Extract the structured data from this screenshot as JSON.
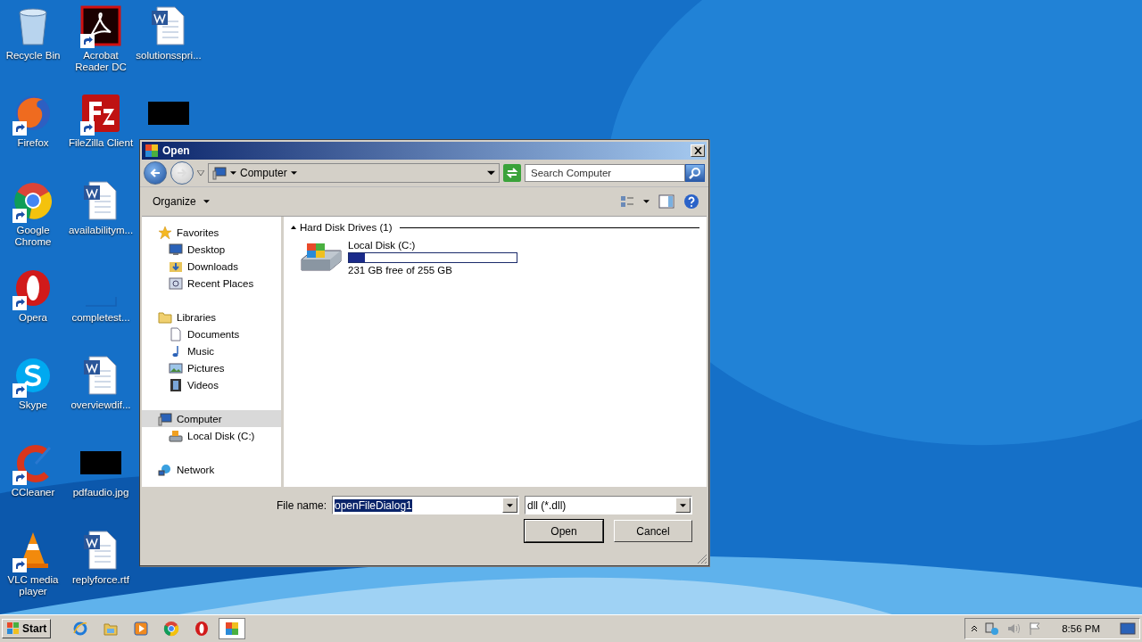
{
  "desktop": {
    "icons": [
      {
        "kind": "recycle",
        "label": "Recycle Bin",
        "shortcut": false
      },
      {
        "kind": "firefox",
        "label": "Firefox",
        "shortcut": true
      },
      {
        "kind": "chrome",
        "label": "Google Chrome",
        "shortcut": true
      },
      {
        "kind": "opera",
        "label": "Opera",
        "shortcut": true
      },
      {
        "kind": "skype",
        "label": "Skype",
        "shortcut": true
      },
      {
        "kind": "ccleaner",
        "label": "CCleaner",
        "shortcut": true
      },
      {
        "kind": "vlc",
        "label": "VLC media player",
        "shortcut": true
      },
      {
        "kind": "pdf",
        "label": "Acrobat Reader DC",
        "shortcut": true
      },
      {
        "kind": "filezilla",
        "label": "FileZilla Client",
        "shortcut": true
      },
      {
        "kind": "word",
        "label": "availabilitym...",
        "shortcut": false
      },
      {
        "kind": "empty",
        "label": "completest...",
        "shortcut": false
      },
      {
        "kind": "word",
        "label": "overviewdif...",
        "shortcut": false
      },
      {
        "kind": "black",
        "label": "pdfaudio.jpg",
        "shortcut": false
      },
      {
        "kind": "word",
        "label": "replyforce.rtf",
        "shortcut": false
      },
      {
        "kind": "word",
        "label": "solutionsspri...",
        "shortcut": false
      },
      {
        "kind": "black",
        "shortcut": false
      }
    ]
  },
  "dialog": {
    "title": "Open",
    "address": {
      "location": "Computer"
    },
    "search": {
      "placeholder": "Search Computer"
    },
    "toolbar": {
      "organize": "Organize"
    },
    "nav": [
      {
        "label": "Favorites",
        "kind": "star",
        "selected": false,
        "children": [
          {
            "label": "Desktop",
            "kind": "desktop",
            "selected": false
          },
          {
            "label": "Downloads",
            "kind": "downloads",
            "selected": false
          },
          {
            "label": "Recent Places",
            "kind": "recent",
            "selected": false
          }
        ]
      },
      {
        "label": "Libraries",
        "kind": "folder",
        "selected": false,
        "children": [
          {
            "label": "Documents",
            "kind": "document",
            "selected": false
          },
          {
            "label": "Music",
            "kind": "music",
            "selected": false
          },
          {
            "label": "Pictures",
            "kind": "pictures",
            "selected": false
          },
          {
            "label": "Videos",
            "kind": "videos",
            "selected": false
          }
        ]
      },
      {
        "label": "Computer",
        "kind": "computer",
        "selected": true,
        "children": [
          {
            "label": "Local Disk (C:)",
            "kind": "disk",
            "selected": false
          }
        ]
      },
      {
        "label": "Network",
        "kind": "network",
        "selected": false
      }
    ],
    "groups": [
      {
        "title": "Hard Disk Drives (1)",
        "expanded": true,
        "drives": [
          {
            "name": "Local Disk (C:)",
            "level": 0.095,
            "free": "231 GB free of 255 GB",
            "selected": false
          }
        ]
      }
    ],
    "file_name": {
      "label": "File name:",
      "value": "openFileDialog1",
      "value_selected": true
    },
    "filter": {
      "value": "dll (*.dll)"
    },
    "buttons": [
      {
        "label": "Open",
        "default": true
      },
      {
        "label": "Cancel",
        "default": false
      }
    ]
  },
  "taskbar": {
    "start": "Start",
    "items": [
      {
        "kind": "ie",
        "active": false
      },
      {
        "kind": "explorer",
        "active": false
      },
      {
        "kind": "media",
        "active": false
      },
      {
        "kind": "chrome",
        "active": false
      },
      {
        "kind": "opera",
        "active": false
      },
      {
        "kind": "window",
        "active": true
      }
    ],
    "tray": {
      "clock": "8:56 PM"
    }
  }
}
